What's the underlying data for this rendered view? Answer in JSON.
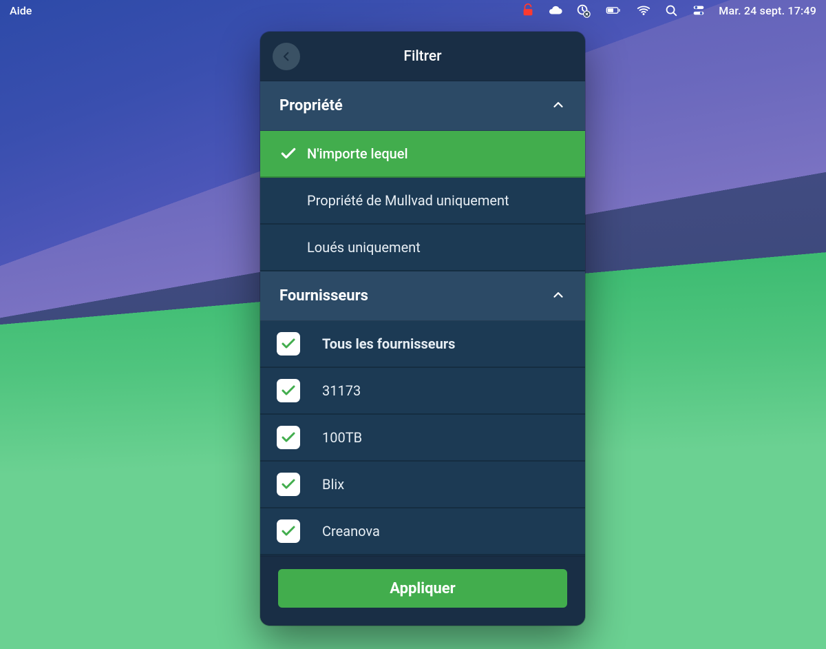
{
  "menubar": {
    "left_item": "Aide",
    "datetime": "Mar. 24 sept.  17:49"
  },
  "app": {
    "title": "Filtrer",
    "apply_label": "Appliquer",
    "sections": {
      "ownership": {
        "title": "Propriété",
        "options": [
          {
            "label": "N'importe lequel",
            "selected": true
          },
          {
            "label": "Propriété de Mullvad uniquement",
            "selected": false
          },
          {
            "label": "Loués uniquement",
            "selected": false
          }
        ]
      },
      "providers": {
        "title": "Fournisseurs",
        "items": [
          {
            "label": "Tous les fournisseurs",
            "checked": true,
            "bold": true
          },
          {
            "label": "31173",
            "checked": true,
            "bold": false
          },
          {
            "label": "100TB",
            "checked": true,
            "bold": false
          },
          {
            "label": "Blix",
            "checked": true,
            "bold": false
          },
          {
            "label": "Creanova",
            "checked": true,
            "bold": false
          }
        ]
      }
    }
  },
  "colors": {
    "accent_green": "#42ad4d",
    "panel_bg": "#192e45",
    "row_bg": "#1c3a54",
    "section_bg": "#2c4a66"
  }
}
